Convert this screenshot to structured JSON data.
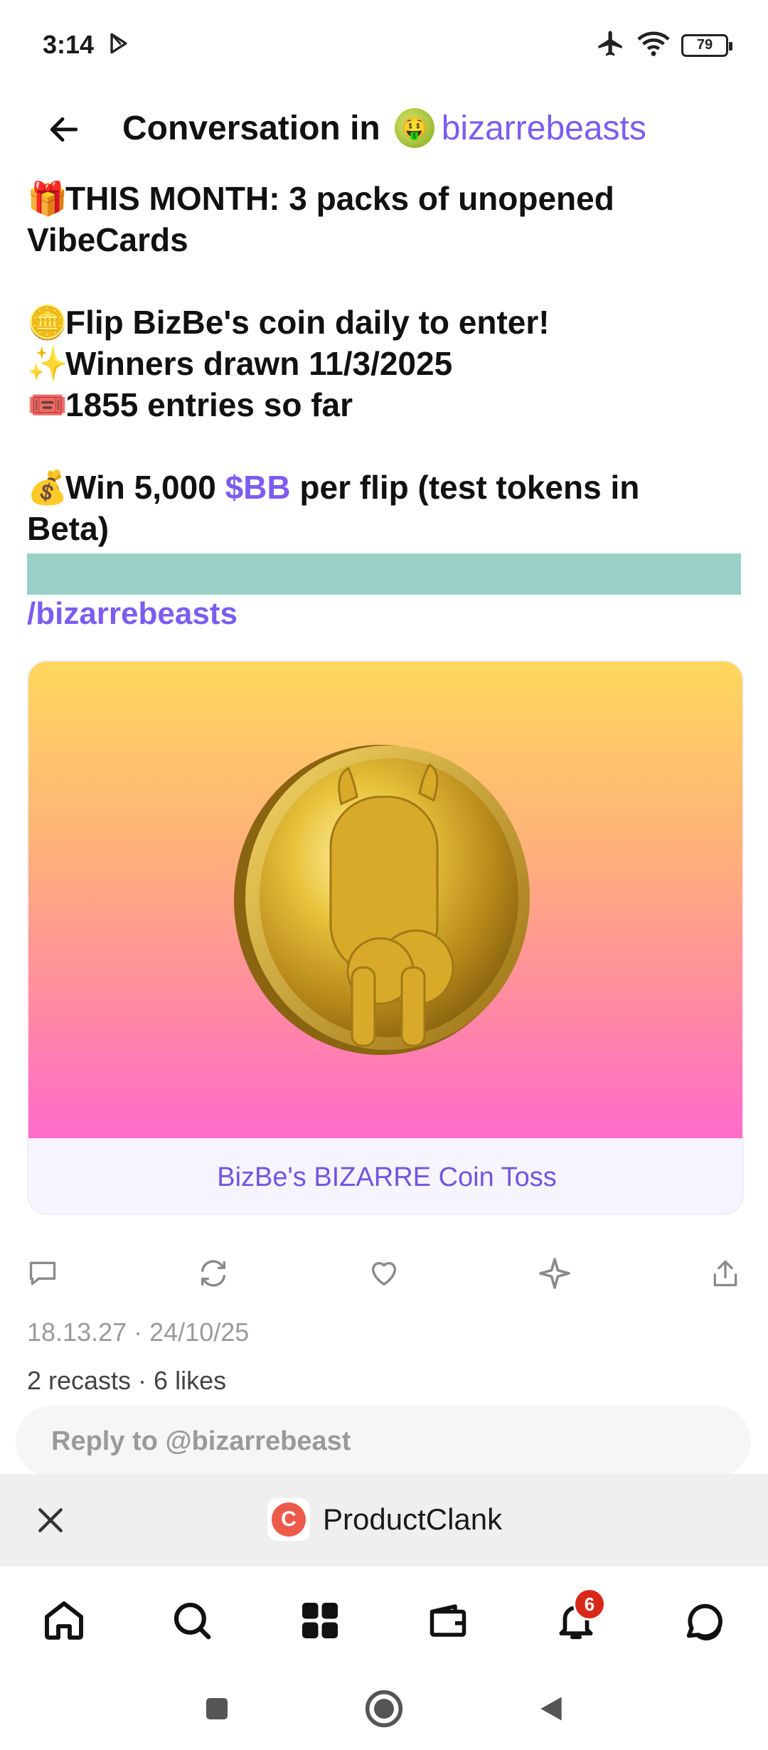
{
  "status_bar": {
    "time": "3:14",
    "battery": "79",
    "icons": [
      "play-store-icon",
      "airplane-icon",
      "wifi-icon",
      "battery-icon"
    ]
  },
  "header": {
    "prefix": "Conversation in",
    "channel": "bizarrebeasts",
    "back_icon": "arrow-left-icon"
  },
  "post": {
    "lines": [
      {
        "emoji": "🎁",
        "text": "THIS MONTH: 3 packs of unopened"
      },
      {
        "emoji": "",
        "text": "VibeCards"
      },
      {
        "emoji": "🪙",
        "text": "Flip BizBe's coin daily to enter!"
      },
      {
        "emoji": "✨",
        "text": "Winners drawn 11/3/2025"
      },
      {
        "emoji": "🎟️",
        "text": "1855 entries so far"
      },
      {
        "emoji": "💰",
        "text_before": "Win 5,000 ",
        "token": "$BB",
        "text_after": " per flip (test tokens in"
      },
      {
        "emoji": "",
        "text": "Beta)"
      }
    ],
    "channel_link": "/bizarrebeasts"
  },
  "embed": {
    "title": "BizBe's BIZARRE Coin Toss"
  },
  "actions": [
    "comment-icon",
    "recast-icon",
    "heart-icon",
    "sparkle-icon",
    "share-icon"
  ],
  "meta": {
    "timestamp": "18.13.27 · 24/10/25",
    "stats": "2 recasts · 6 likes"
  },
  "reply": {
    "placeholder": "Reply to @bizarrebeast"
  },
  "mini_app": {
    "name": "ProductClank",
    "logo_letter": "C"
  },
  "bottom_nav": {
    "items": [
      "home-icon",
      "search-icon",
      "apps-icon",
      "wallet-icon",
      "bell-icon",
      "chat-icon"
    ],
    "notification_count": "6"
  },
  "colors": {
    "accent": "#7c5cf0",
    "teal": "#99d0c8",
    "badge": "#d8281a"
  }
}
